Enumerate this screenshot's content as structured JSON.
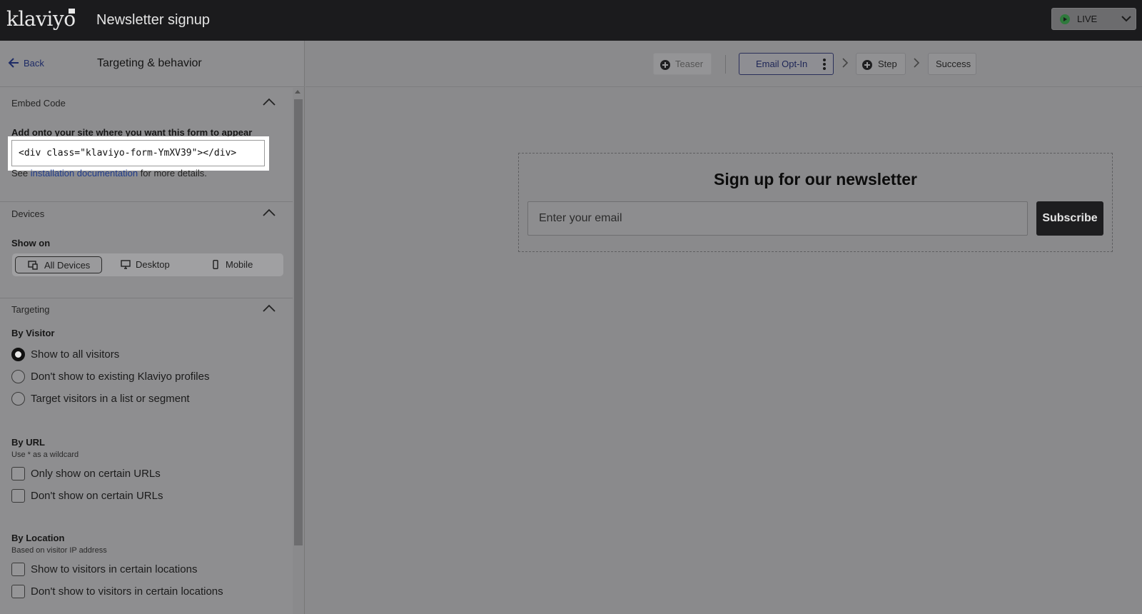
{
  "app": {
    "logo": "klaviyo",
    "title": "Newsletter signup",
    "status_label": "LIVE"
  },
  "sidebar": {
    "back_label": "Back",
    "title": "Targeting & behavior",
    "embed": {
      "title": "Embed Code",
      "label": "Add onto your site where you want this form to appear",
      "code": "<div class=\"klaviyo-form-YmXV39\"></div>",
      "see_prefix": "See ",
      "link": "installation documentation",
      "see_suffix": " for more details."
    },
    "devices": {
      "title": "Devices",
      "show_on": "Show on",
      "options": [
        "All Devices",
        "Desktop",
        "Mobile"
      ],
      "selected": "All Devices"
    },
    "targeting": {
      "title": "Targeting",
      "by_visitor": "By Visitor",
      "visitor_options": [
        "Show to all visitors",
        "Don't show to existing Klaviyo profiles",
        "Target visitors in a list or segment"
      ],
      "visitor_selected": "Show to all visitors",
      "by_url": "By URL",
      "url_hint": "Use * as a wildcard",
      "url_options": [
        "Only show on certain URLs",
        "Don't show on certain URLs"
      ],
      "by_location": "By Location",
      "location_hint": "Based on visitor IP address",
      "location_options": [
        "Show to visitors in certain locations",
        "Don't show to visitors in certain locations"
      ]
    }
  },
  "steps": {
    "teaser": "Teaser",
    "email_opt_in": "Email Opt-In",
    "step": "Step",
    "success": "Success"
  },
  "form": {
    "title": "Sign up for our newsletter",
    "email_placeholder": "Enter your email",
    "subscribe_label": "Subscribe"
  },
  "colors": {
    "topbar": "#1b1b1d",
    "sidebar": "#8e8e90",
    "canvas": "#8a8a8c",
    "link": "#1e3a8a",
    "live_dot": "#2f7a3c",
    "subscribe_bg": "#1d1d1f"
  },
  "icons": [
    "back-arrow-icon",
    "chevron-up-icon",
    "chevron-down-icon",
    "all-devices-icon",
    "desktop-icon",
    "mobile-icon",
    "plus-circle-icon",
    "chevron-right-icon",
    "kebab-icon",
    "play-icon"
  ]
}
